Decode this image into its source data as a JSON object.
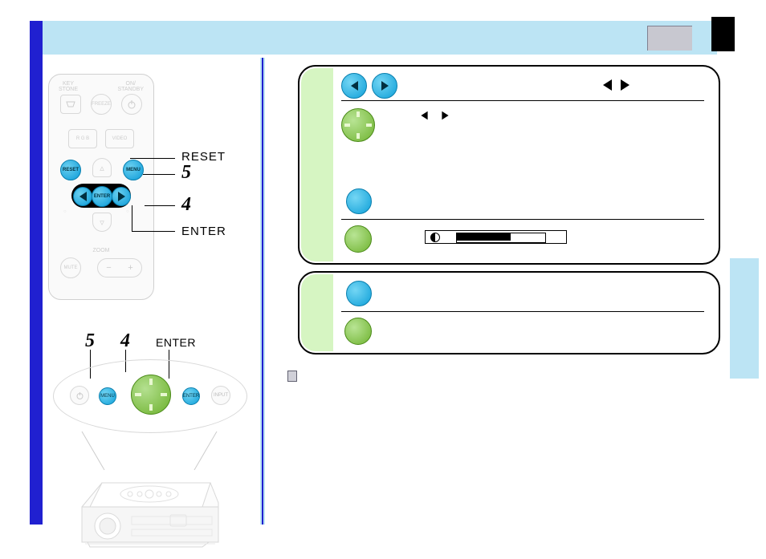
{
  "remote": {
    "top_left_label": "KEY\nSTONE",
    "top_right_label": "ON/\nSTANDBY",
    "freeze_label": "FREEZE",
    "rgb_label": "R G B",
    "video_label": "VIDEO",
    "reset_label": "RESET",
    "menu_label": "MENU",
    "enter_label": "ENTER",
    "zoom_label": "ZOOM",
    "mute_label": "MUTE"
  },
  "callouts": {
    "reset": "RESET",
    "step5": "5",
    "step4": "4",
    "enter": "ENTER"
  },
  "panel": {
    "step5": "5",
    "step4": "4",
    "enter": "ENTER",
    "menu_label": "MENU",
    "enter_label": "ENTER",
    "input_label": "INPUT"
  },
  "step4_card": {},
  "step5_card": {}
}
